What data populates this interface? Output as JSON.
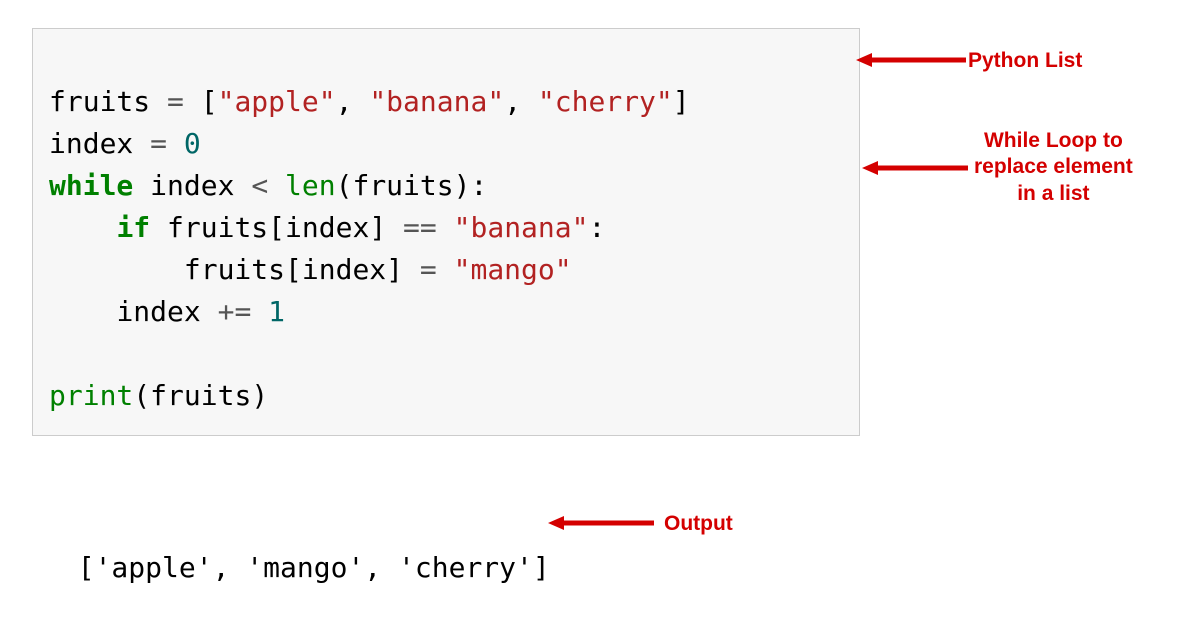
{
  "code": {
    "line1": {
      "var": "fruits",
      "eq": " = ",
      "lb": "[",
      "s1": "\"apple\"",
      "c1": ", ",
      "s2": "\"banana\"",
      "c2": ", ",
      "s3": "\"cherry\"",
      "rb": "]"
    },
    "line2": {
      "var": "index",
      "eq": " = ",
      "num": "0"
    },
    "line3": {
      "kw": "while",
      "sp1": " ",
      "var": "index",
      "sp2": " ",
      "lt": "<",
      "sp3": " ",
      "fn": "len",
      "lp": "(",
      "arg": "fruits",
      "rp": "):"
    },
    "line4": {
      "indent": "    ",
      "kw": "if",
      "sp1": " ",
      "var": "fruits",
      "lb": "[",
      "idx": "index",
      "rb": "]",
      "sp2": " ",
      "eqeq": "==",
      "sp3": " ",
      "str": "\"banana\"",
      "colon": ":"
    },
    "line5": {
      "indent": "        ",
      "var": "fruits",
      "lb": "[",
      "idx": "index",
      "rb": "]",
      "eq": " = ",
      "str": "\"mango\""
    },
    "line6": {
      "indent": "    ",
      "var": "index",
      "sp": " ",
      "pluseq": "+=",
      "sp2": " ",
      "num": "1"
    },
    "line7": {
      "blank": ""
    },
    "line8": {
      "fn": "print",
      "lp": "(",
      "arg": "fruits",
      "rp": ")"
    }
  },
  "output": {
    "text": "['apple', 'mango', 'cherry']"
  },
  "annotations": {
    "list_label": "Python List",
    "loop_label": "While Loop to\nreplace element\nin a list",
    "output_label": "Output"
  },
  "colors": {
    "accent": "#d40000"
  }
}
